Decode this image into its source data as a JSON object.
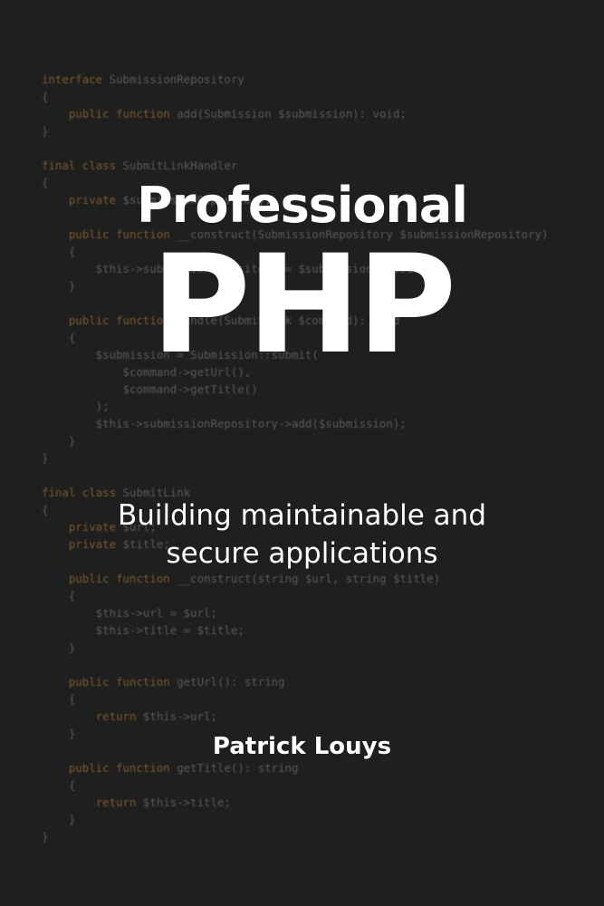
{
  "cover": {
    "title_line1": "Professional",
    "title_line2": "PHP",
    "subtitle_line1": "Building maintainable and",
    "subtitle_line2": "secure applications",
    "author": "Patrick Louys"
  },
  "background_code": [
    "interface SubmissionRepository",
    "{",
    "    public function add(Submission $submission): void;",
    "}",
    "",
    "final class SubmitLinkHandler",
    "{",
    "    private $submissionRepository;",
    "",
    "    public function __construct(SubmissionRepository $submissionRepository)",
    "    {",
    "        $this->submissionRepository = $submissionRepository;",
    "    }",
    "",
    "    public function handle(SubmitLink $command): void",
    "    {",
    "        $submission = Submission::submit(",
    "            $command->getUrl(),",
    "            $command->getTitle()",
    "        );",
    "        $this->submissionRepository->add($submission);",
    "    }",
    "}",
    "",
    "final class SubmitLink",
    "{",
    "    private $url;",
    "    private $title;",
    "",
    "    public function __construct(string $url, string $title)",
    "    {",
    "        $this->url = $url;",
    "        $this->title = $title;",
    "    }",
    "",
    "    public function getUrl(): string",
    "    {",
    "        return $this->url;",
    "    }",
    "",
    "    public function getTitle(): string",
    "    {",
    "        return $this->title;",
    "    }",
    "}"
  ],
  "colors": {
    "background": "#1f1f1f",
    "code_text": "#5a5a5a",
    "code_keyword": "#7a5a2e",
    "title_text": "#ffffff"
  }
}
